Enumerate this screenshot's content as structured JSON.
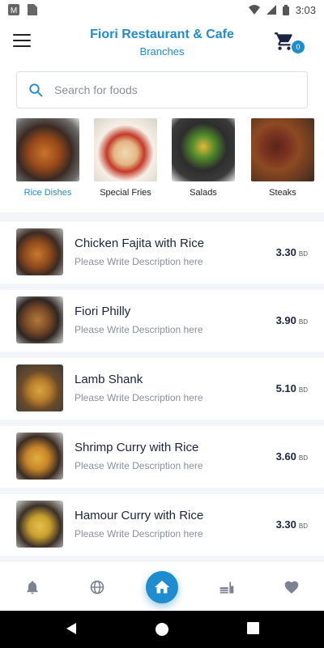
{
  "status_bar": {
    "time": "3:03"
  },
  "header": {
    "title": "Fiori Restaurant & Cafe",
    "subtitle": "Branches",
    "cart_count": "0"
  },
  "search": {
    "placeholder": "Search for foods",
    "value": ""
  },
  "categories": [
    {
      "label": "Rice Dishes",
      "active": true
    },
    {
      "label": "Special Fries",
      "active": false
    },
    {
      "label": "Salads",
      "active": false
    },
    {
      "label": "Steaks",
      "active": false
    }
  ],
  "foods": [
    {
      "name": "Chicken Fajita with Rice",
      "description": "Please Write Description here",
      "price": "3.30",
      "currency": "BD"
    },
    {
      "name": "Fiori Philly",
      "description": "Please Write Description here",
      "price": "3.90",
      "currency": "BD"
    },
    {
      "name": "Lamb Shank",
      "description": "Please Write Description here",
      "price": "5.10",
      "currency": "BD"
    },
    {
      "name": "Shrimp Curry with Rice",
      "description": "Please Write Description here",
      "price": "3.60",
      "currency": "BD"
    },
    {
      "name": "Hamour Curry with Rice",
      "description": "Please Write Description here",
      "price": "3.30",
      "currency": "BD"
    }
  ],
  "bottom_nav": [
    "bell-icon",
    "globe-icon",
    "home-icon",
    "menu-food-icon",
    "heart-icon"
  ],
  "colors": {
    "accent": "#1f8ccf",
    "text_dark": "#1c2340",
    "text_muted": "#8a8f9c",
    "list_bg": "#f4f5f8"
  }
}
